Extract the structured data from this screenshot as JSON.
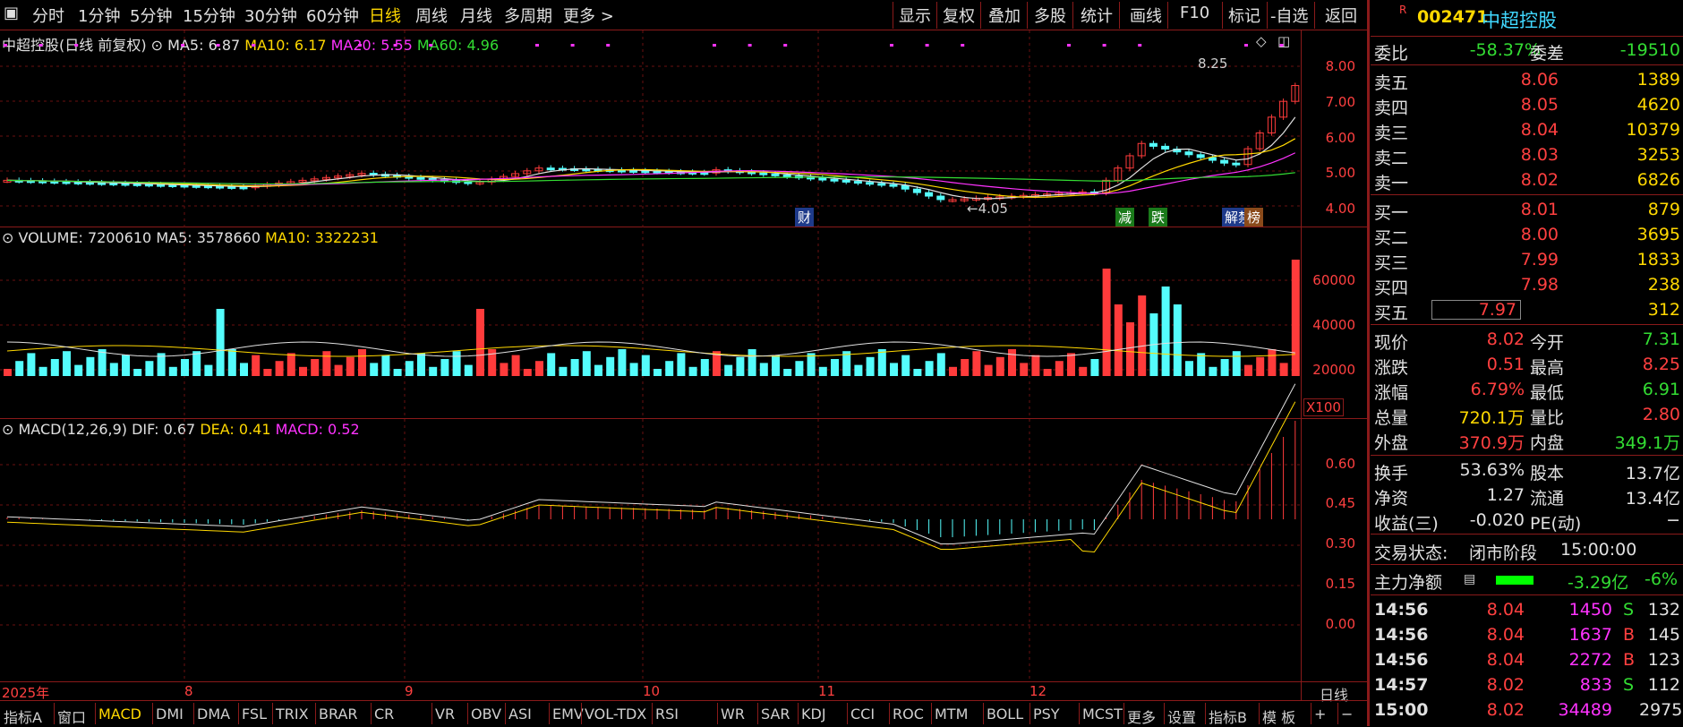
{
  "toolbar": {
    "left": [
      "分时",
      "1分钟",
      "5分钟",
      "15分钟",
      "30分钟",
      "60分钟",
      "日线",
      "周线",
      "月线",
      "多周期",
      "更多 >"
    ],
    "active": "日线",
    "right": [
      "显示",
      "复权",
      "叠加",
      "多股",
      "统计",
      "画线",
      "F10",
      "标记",
      "-自选",
      "返回"
    ]
  },
  "main": {
    "legend": {
      "name": "中超控股(日线 前复权)",
      "ma5": "MA5: 6.87",
      "ma10": "MA10: 6.17",
      "ma20": "MA20: 5.55",
      "ma60": "MA60: 4.96"
    },
    "yaxis": [
      "8.00",
      "7.00",
      "6.00",
      "5.00",
      "4.00"
    ],
    "high_label": "8.25",
    "low_label": "4.05",
    "tags": [
      "财",
      "减",
      "跌",
      "解禁",
      "榜"
    ]
  },
  "volume": {
    "legend": {
      "name": "VOLUME: 7200610",
      "ma5": "MA5: 3578660",
      "ma10": "MA10: 3322231"
    },
    "yaxis": [
      "60000",
      "40000",
      "20000"
    ],
    "unit": "X100"
  },
  "macd": {
    "legend": {
      "name": "MACD(12,26,9)",
      "dif": "DIF: 0.67",
      "dea": "DEA: 0.41",
      "macd": "MACD: 0.52"
    },
    "yaxis": [
      "0.60",
      "0.45",
      "0.30",
      "0.15",
      "0.00"
    ]
  },
  "dates": [
    "2025年",
    "8",
    "9",
    "10",
    "11",
    "12"
  ],
  "period_label": "日线",
  "bottom": {
    "items": [
      "指标A",
      "窗口",
      "MACD",
      "DMI",
      "DMA",
      "FSL",
      "TRIX",
      "BRAR",
      "CR",
      "VR",
      "OBV",
      "ASI",
      "EMV",
      "VOL-TDX",
      "RSI",
      "WR",
      "SAR",
      "KDJ",
      "CCI",
      "ROC",
      "MTM",
      "BOLL",
      "PSY",
      "MCST",
      "更多",
      "设置",
      "指标B",
      "模 板",
      "+",
      "−"
    ],
    "active": "MACD"
  },
  "quote": {
    "code": "002471",
    "name": "中超控股",
    "badge": "R",
    "wb": {
      "label": "委比",
      "value": "-58.37%",
      "label2": "委差",
      "value2": "-19510"
    },
    "asks": [
      {
        "label": "卖五",
        "price": "8.06",
        "vol": "1389"
      },
      {
        "label": "卖四",
        "price": "8.05",
        "vol": "4620"
      },
      {
        "label": "卖三",
        "price": "8.04",
        "vol": "10379"
      },
      {
        "label": "卖二",
        "price": "8.03",
        "vol": "3253"
      },
      {
        "label": "卖一",
        "price": "8.02",
        "vol": "6826"
      }
    ],
    "bids": [
      {
        "label": "买一",
        "price": "8.01",
        "vol": "879"
      },
      {
        "label": "买二",
        "price": "8.00",
        "vol": "3695"
      },
      {
        "label": "买三",
        "price": "7.99",
        "vol": "1833"
      },
      {
        "label": "买四",
        "price": "7.98",
        "vol": "238"
      },
      {
        "label": "买五",
        "price": "7.97",
        "vol": "312"
      }
    ],
    "stats": [
      {
        "l1": "现价",
        "v1": "8.02",
        "l2": "今开",
        "v2": "7.31"
      },
      {
        "l1": "涨跌",
        "v1": "0.51",
        "l2": "最高",
        "v2": "8.25"
      },
      {
        "l1": "涨幅",
        "v1": "6.79%",
        "l2": "最低",
        "v2": "6.91"
      },
      {
        "l1": "总量",
        "v1": "720.1万",
        "l2": "量比",
        "v2": "2.80"
      },
      {
        "l1": "外盘",
        "v1": "370.9万",
        "l2": "内盘",
        "v2": "349.1万"
      }
    ],
    "info": [
      {
        "l1": "换手",
        "v1": "53.63%",
        "l2": "股本",
        "v2": "13.7亿"
      },
      {
        "l1": "净资",
        "v1": "1.27",
        "l2": "流通",
        "v2": "13.4亿"
      },
      {
        "l1": "收益(三)",
        "v1": "-0.020",
        "l2": "PE(动)",
        "v2": "−"
      }
    ],
    "status": {
      "label": "交易状态:",
      "value": "闭市阶段",
      "time": "15:00:00"
    },
    "flow": {
      "label": "主力净额",
      "value": "-3.29亿",
      "pct": "-6%"
    },
    "ticks": [
      {
        "t": "14:56",
        "p": "8.04",
        "v": "1450",
        "s": "S",
        "n": "132"
      },
      {
        "t": "14:56",
        "p": "8.04",
        "v": "1637",
        "s": "B",
        "n": "145"
      },
      {
        "t": "14:56",
        "p": "8.04",
        "v": "2272",
        "s": "B",
        "n": "123"
      },
      {
        "t": "14:57",
        "p": "8.02",
        "v": "833",
        "s": "S",
        "n": "112"
      },
      {
        "t": "15:00",
        "p": "8.02",
        "v": "34489",
        "s": "",
        "n": "2975"
      }
    ]
  },
  "colors": {
    "up": "#ff3b3b",
    "down": "#54fcfc",
    "grid": "#8a1a1a"
  }
}
